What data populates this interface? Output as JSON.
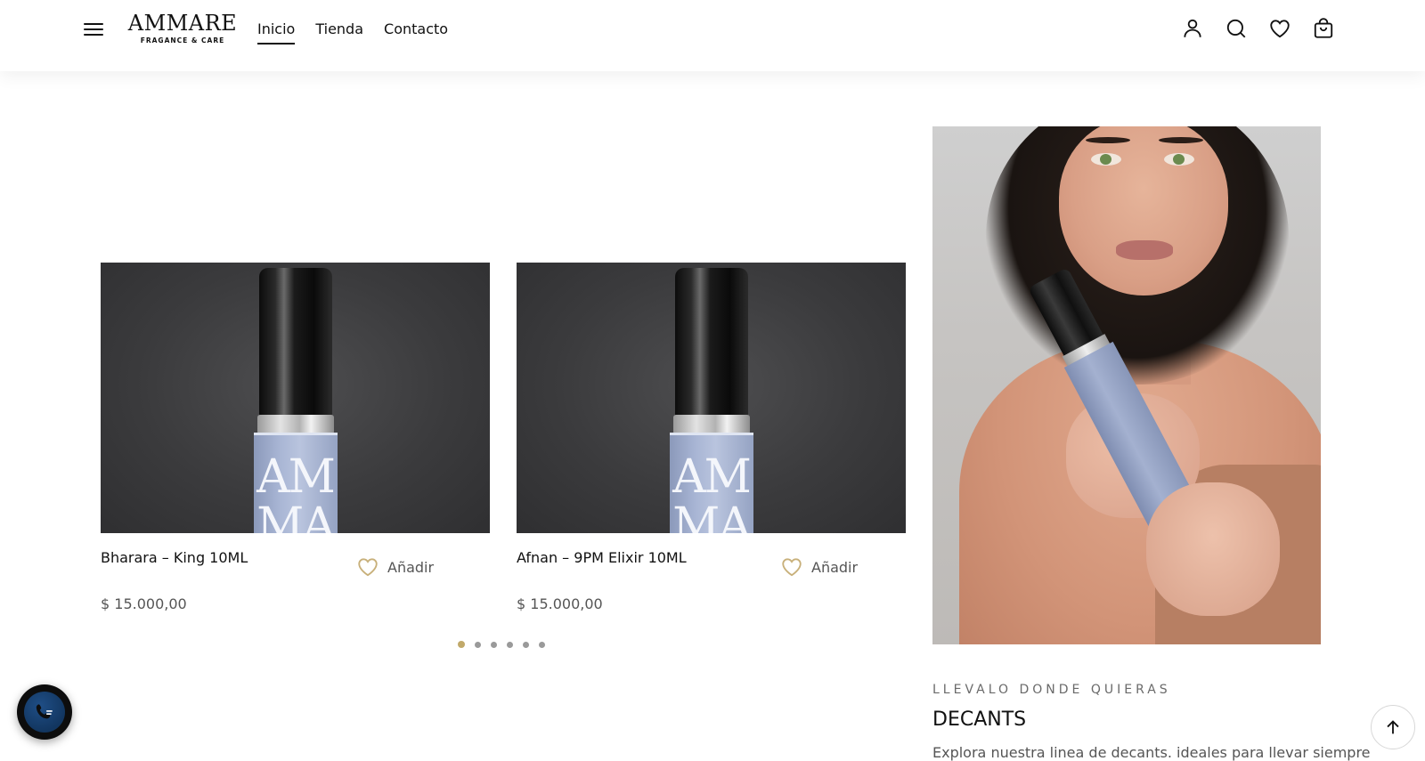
{
  "brand": {
    "name": "AMMARE",
    "tagline": "FRAGANCE & CARE"
  },
  "nav": [
    {
      "label": "Inicio",
      "active": true
    },
    {
      "label": "Tienda",
      "active": false
    },
    {
      "label": "Contacto",
      "active": false
    }
  ],
  "header_icons": [
    "account-icon",
    "search-icon",
    "wishlist-heart-icon",
    "shopping-bag-icon"
  ],
  "products": [
    {
      "title": "Bharara – King 10ML",
      "price": "$ 15.000,00",
      "add_label": "Añadir",
      "bottle_text": "AM\nMA"
    },
    {
      "title": "Afnan – 9PM Elixir 10ML",
      "price": "$ 15.000,00",
      "add_label": "Añadir",
      "bottle_text": "AM\nMA"
    }
  ],
  "carousel": {
    "total_pages": 6,
    "current_page": 1
  },
  "promo": {
    "eyebrow": "LLEVALO DONDE QUIERAS",
    "title": "DECANTS",
    "description": "Explora nuestra linea de decants. ideales para llevar siempre"
  },
  "colors": {
    "accent_gold": "#c1a96a",
    "text": "#111111",
    "muted": "#555555"
  }
}
